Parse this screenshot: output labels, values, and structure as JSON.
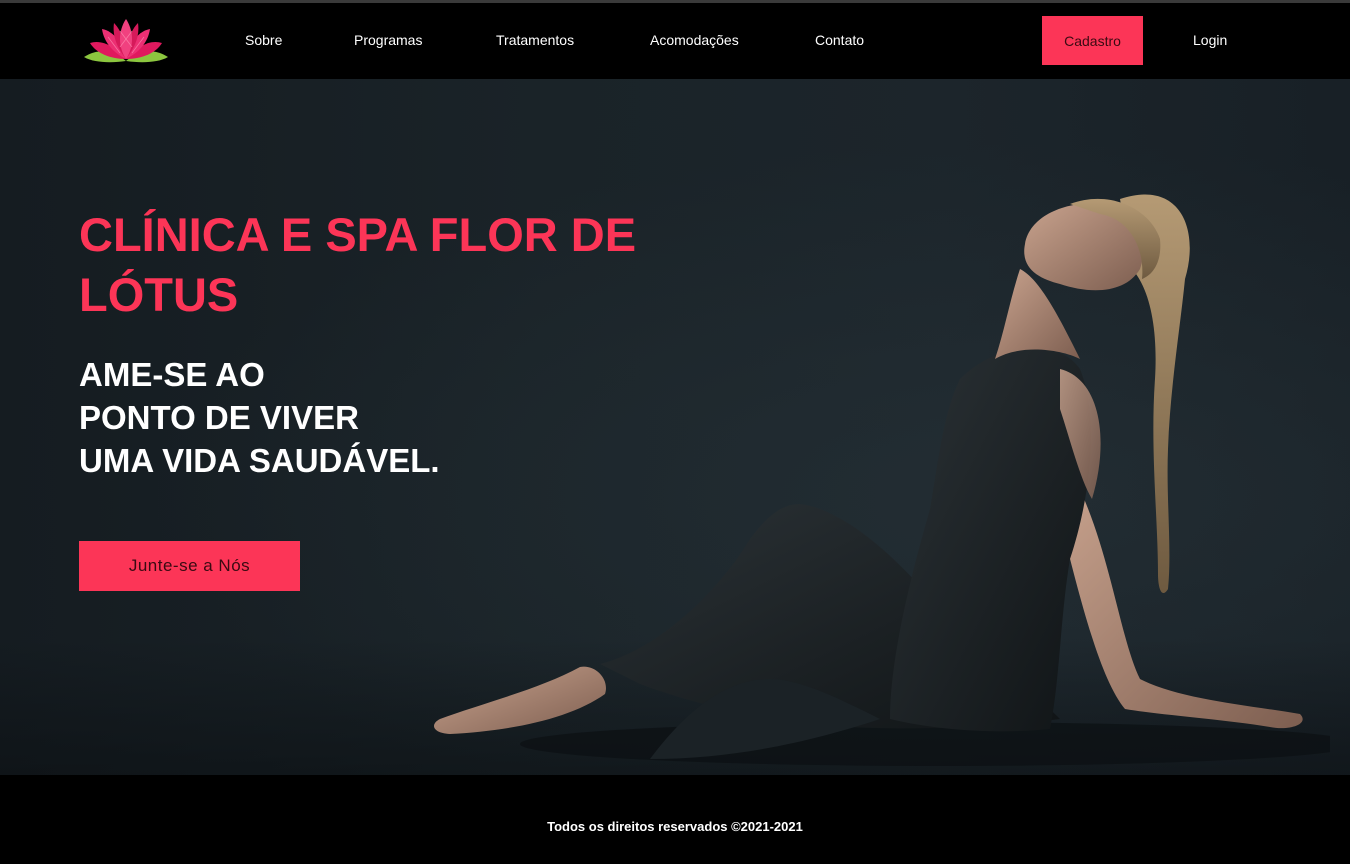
{
  "brand": {
    "logo_icon": "lotus-flower-icon",
    "accent_color": "#fc3557"
  },
  "nav": {
    "items": [
      {
        "label": "Sobre"
      },
      {
        "label": "Programas"
      },
      {
        "label": "Tratamentos"
      },
      {
        "label": "Acomodações"
      },
      {
        "label": "Contato"
      }
    ],
    "signup_label": "Cadastro",
    "login_label": "Login"
  },
  "hero": {
    "title": "CLÍNICA E SPA FLOR DE LÓTUS",
    "subtitle_lines": [
      "AME-SE AO",
      "PONTO DE VIVER",
      "UMA VIDA SAUDÁVEL."
    ],
    "cta_label": "Junte-se a Nós"
  },
  "footer": {
    "copyright": "Todos os direitos reservados ©2021-2021"
  }
}
